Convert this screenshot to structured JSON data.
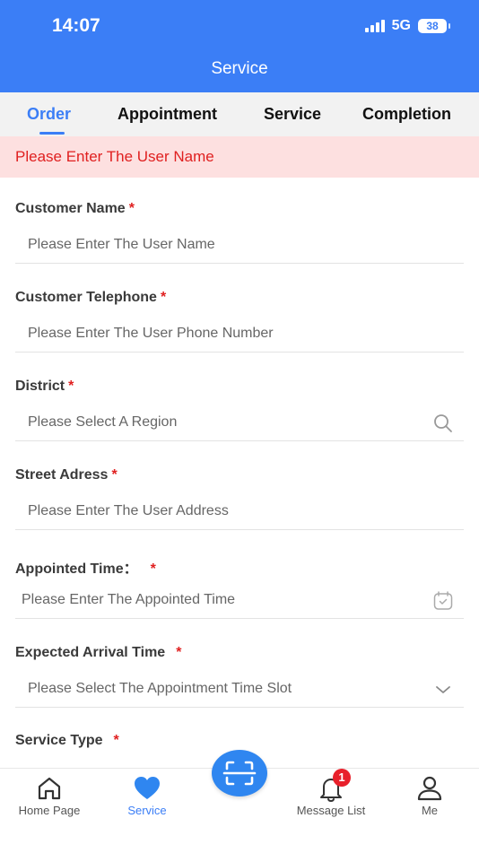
{
  "status_bar": {
    "time": "14:07",
    "network": "5G",
    "battery": "38"
  },
  "header": {
    "title": "Service"
  },
  "tabs": [
    {
      "label": "Order",
      "active": true
    },
    {
      "label": "Appointment",
      "active": false
    },
    {
      "label": "Service",
      "active": false
    },
    {
      "label": "Completion",
      "active": false
    }
  ],
  "alert": {
    "message": "Please Enter The User Name"
  },
  "form": {
    "required_mark": "*",
    "fields": [
      {
        "label": "Customer Name",
        "placeholder": "Please Enter The User Name",
        "icon": ""
      },
      {
        "label": "Customer Telephone",
        "placeholder": "Please Enter The User Phone Number",
        "icon": ""
      },
      {
        "label": "District",
        "placeholder": "Please Select A Region",
        "icon": "search-icon"
      },
      {
        "label": "Street Adress",
        "placeholder": "Please Enter The User Address",
        "icon": ""
      },
      {
        "label": "Appointed Time：",
        "placeholder": "Please Enter The Appointed Time",
        "icon": "calendar-icon"
      },
      {
        "label": "Expected Arrival Time",
        "placeholder": "Please Select The Appointment Time Slot",
        "icon": "chevron-down-icon"
      },
      {
        "label": "Service Type",
        "placeholder": "",
        "icon": ""
      }
    ]
  },
  "bottom_nav": {
    "items": [
      {
        "label": "Home Page",
        "icon": "home-icon",
        "active": false
      },
      {
        "label": "Service",
        "icon": "heart-icon",
        "active": true
      },
      {
        "label": "Message List",
        "icon": "bell-icon",
        "active": false,
        "badge": "1"
      },
      {
        "label": "Me",
        "icon": "user-icon",
        "active": false
      }
    ],
    "center_button_icon": "scan-icon"
  },
  "colors": {
    "primary": "#3b7ef6",
    "alert_bg": "#fde0e0",
    "alert_text": "#e02020",
    "badge": "#e8202b"
  }
}
